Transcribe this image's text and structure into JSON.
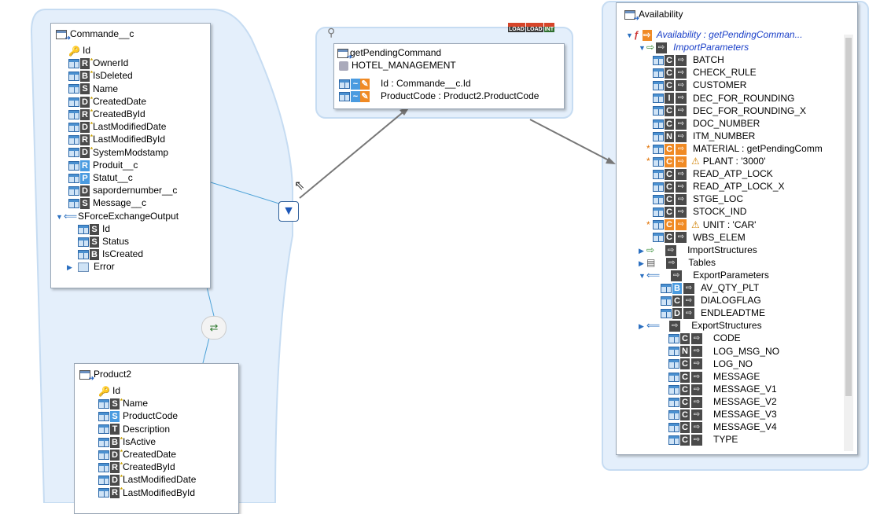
{
  "commande": {
    "title": "Commande__c",
    "fields": [
      {
        "badge": "key",
        "label": "Id"
      },
      {
        "badge": "R",
        "label": "OwnerId",
        "star": true
      },
      {
        "badge": "B",
        "label": "IsDeleted",
        "star": true
      },
      {
        "badge": "S",
        "label": "Name"
      },
      {
        "badge": "D",
        "label": "CreatedDate",
        "star": true
      },
      {
        "badge": "R",
        "label": "CreatedById",
        "star": true
      },
      {
        "badge": "D",
        "label": "LastModifiedDate",
        "star": true
      },
      {
        "badge": "R",
        "label": "LastModifiedById",
        "star": true
      },
      {
        "badge": "D",
        "label": "SystemModstamp",
        "star": true
      },
      {
        "badge": "R",
        "label": "Produit__c",
        "blue": true
      },
      {
        "badge": "P",
        "label": "Statut__c",
        "blue": true
      },
      {
        "badge": "D",
        "label": "sapordernumber__c"
      },
      {
        "badge": "S",
        "label": "Message__c"
      }
    ],
    "output": "SForceExchangeOutput",
    "output_fields": [
      {
        "badge": "S",
        "label": "Id"
      },
      {
        "badge": "S",
        "label": "Status"
      },
      {
        "badge": "B",
        "label": "IsCreated"
      }
    ],
    "error": "Error"
  },
  "pending": {
    "title": "getPendingCommand",
    "subtitle": "HOTEL_MANAGEMENT",
    "params": [
      "Id : Commande__c.Id",
      "ProductCode : Product2.ProductCode"
    ],
    "badges": [
      "LOAD",
      "LOAD",
      "INT"
    ]
  },
  "product": {
    "title": "Product2",
    "fields": [
      {
        "badge": "key",
        "label": "Id"
      },
      {
        "badge": "S",
        "label": "Name",
        "star": true
      },
      {
        "badge": "S",
        "label": "ProductCode",
        "blue": true
      },
      {
        "badge": "T",
        "label": "Description"
      },
      {
        "badge": "B",
        "label": "IsActive",
        "star": true
      },
      {
        "badge": "D",
        "label": "CreatedDate",
        "star": true
      },
      {
        "badge": "R",
        "label": "CreatedById",
        "star": true
      },
      {
        "badge": "D",
        "label": "LastModifiedDate",
        "star": true
      },
      {
        "badge": "R",
        "label": "LastModifiedById",
        "star": true
      }
    ]
  },
  "availability": {
    "title": "Availability",
    "root": "Availability : getPendingComman...",
    "import_params_label": "ImportParameters",
    "import_params": [
      {
        "t": "C",
        "label": "BATCH"
      },
      {
        "t": "C",
        "label": "CHECK_RULE"
      },
      {
        "t": "C",
        "label": "CUSTOMER"
      },
      {
        "t": "I",
        "label": "DEC_FOR_ROUNDING"
      },
      {
        "t": "C",
        "label": "DEC_FOR_ROUNDING_X"
      },
      {
        "t": "C",
        "label": "DOC_NUMBER"
      },
      {
        "t": "N",
        "label": "ITM_NUMBER"
      },
      {
        "t": "C",
        "label": "MATERIAL : getPendingComm",
        "mapped": true,
        "req": true
      },
      {
        "t": "C",
        "label": "PLANT : '3000'",
        "mapped": true,
        "req": true,
        "warn": true
      },
      {
        "t": "C",
        "label": "READ_ATP_LOCK"
      },
      {
        "t": "C",
        "label": "READ_ATP_LOCK_X"
      },
      {
        "t": "C",
        "label": "STGE_LOC"
      },
      {
        "t": "C",
        "label": "STOCK_IND"
      },
      {
        "t": "C",
        "label": "UNIT : 'CAR'",
        "mapped": true,
        "req": true,
        "warn": true
      },
      {
        "t": "C",
        "label": "WBS_ELEM"
      }
    ],
    "import_structures": "ImportStructures",
    "tables": "Tables",
    "export_params_label": "ExportParameters",
    "export_params": [
      {
        "t": "B",
        "label": "AV_QTY_PLT",
        "blue": true
      },
      {
        "t": "C",
        "label": "DIALOGFLAG"
      },
      {
        "t": "D",
        "label": "ENDLEADTME"
      }
    ],
    "export_structures": "ExportStructures",
    "export_struct_fields": [
      {
        "t": "C",
        "label": "CODE"
      },
      {
        "t": "N",
        "label": "LOG_MSG_NO"
      },
      {
        "t": "C",
        "label": "LOG_NO"
      },
      {
        "t": "C",
        "label": "MESSAGE"
      },
      {
        "t": "C",
        "label": "MESSAGE_V1"
      },
      {
        "t": "C",
        "label": "MESSAGE_V2"
      },
      {
        "t": "C",
        "label": "MESSAGE_V3"
      },
      {
        "t": "C",
        "label": "MESSAGE_V4"
      },
      {
        "t": "C",
        "label": "TYPE"
      }
    ]
  }
}
